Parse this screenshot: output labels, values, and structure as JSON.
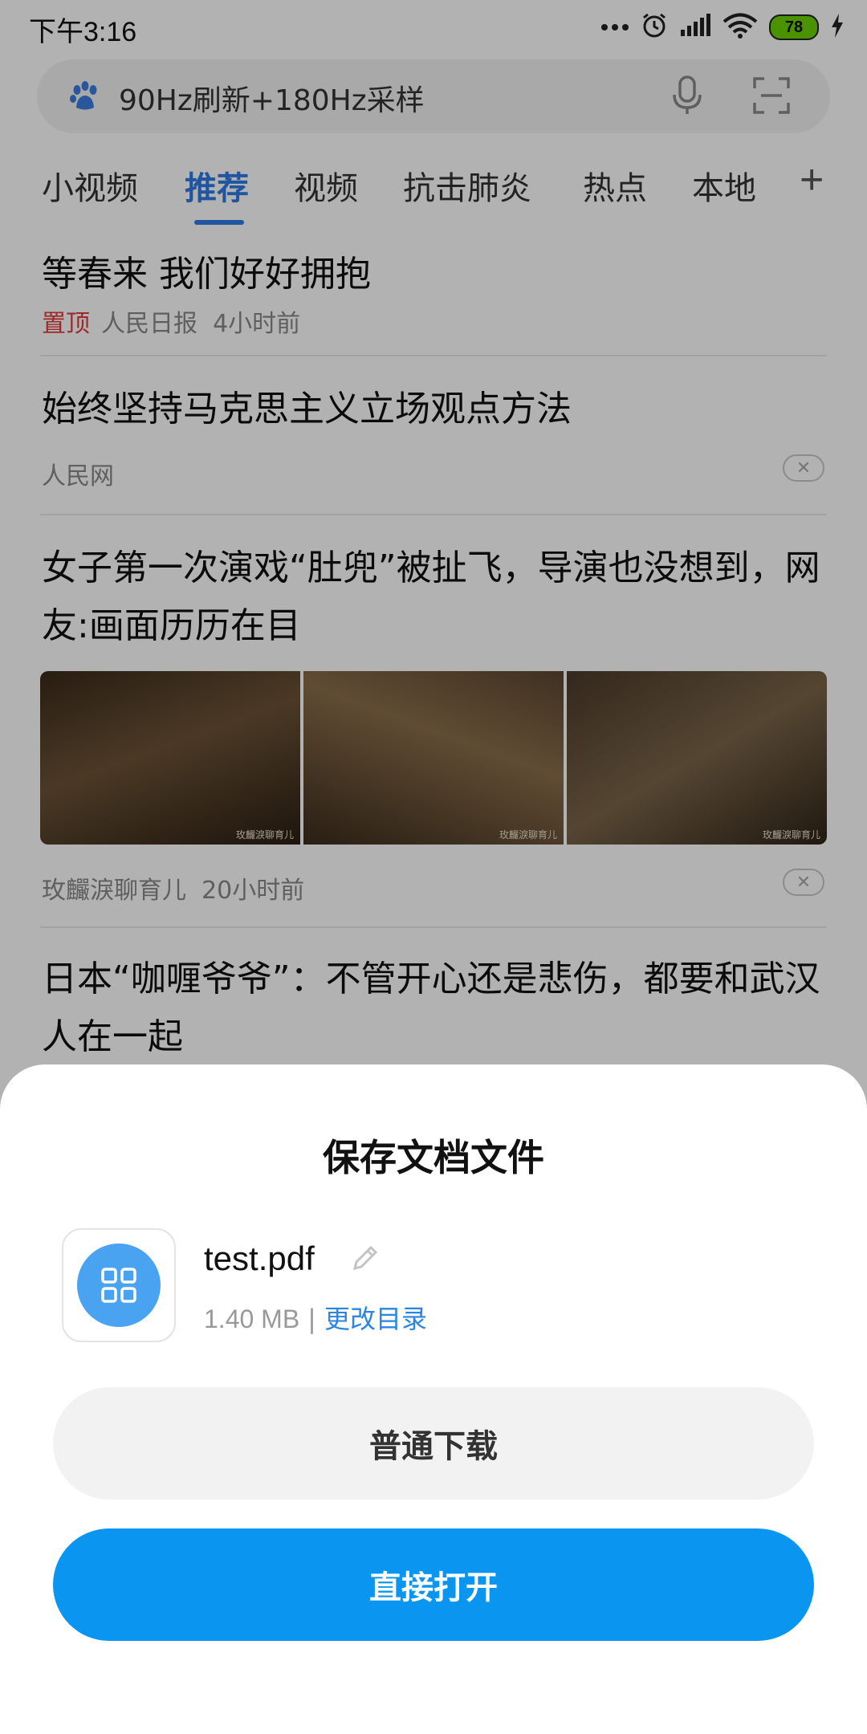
{
  "status_bar": {
    "time": "下午3:16",
    "battery_level": "78"
  },
  "search": {
    "query": "90Hz刷新+180Hz采样"
  },
  "tabs": [
    {
      "label": "小视频"
    },
    {
      "label": "推荐"
    },
    {
      "label": "视频"
    },
    {
      "label": "抗击肺炎"
    },
    {
      "label": "热点"
    },
    {
      "label": "本地"
    }
  ],
  "tabs_add_label": "+",
  "feed": [
    {
      "title": "等春来 我们好好拥抱",
      "tag": "置顶",
      "source": "人民日报",
      "time": "4小时前"
    },
    {
      "title": "始终坚持马克思主义立场观点方法",
      "source": "人民网"
    },
    {
      "title": "女子第一次演戏“肚兜”被扯飞，导演也没想到，网友:画面历历在目",
      "source": "玫麣淚聊育儿",
      "time": "20小时前",
      "thumb_watermark": "玫麣淚聊育儿"
    },
    {
      "title": "日本“咖喱爷爷”：不管开心还是悲伤，都要和武汉人在一起"
    }
  ],
  "dialog": {
    "title": "保存文档文件",
    "file_name": "test.pdf",
    "file_size": "1.40 MB",
    "separator": "|",
    "change_dir_label": "更改目录",
    "normal_download_label": "普通下载",
    "open_directly_label": "直接打开"
  },
  "colors": {
    "accent": "#0a96f0",
    "link": "#2a86e0",
    "tab_active": "#2f7ce6",
    "pin_tag": "#e23b3b",
    "file_icon": "#4aa3f0",
    "battery": "#6ad100"
  }
}
